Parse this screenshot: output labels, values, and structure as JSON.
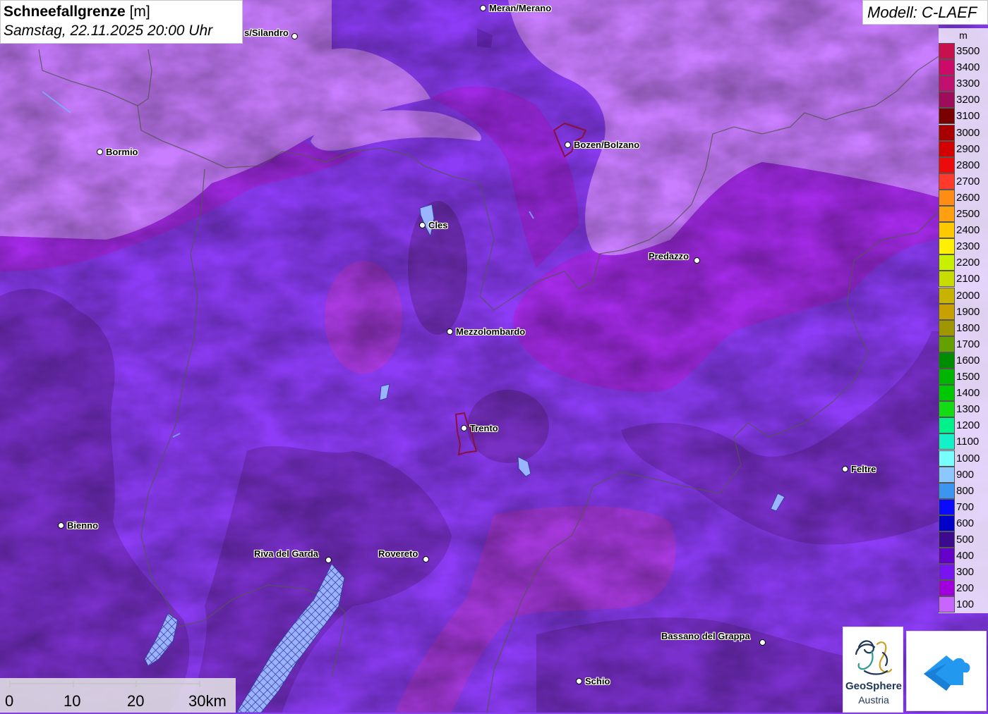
{
  "title": {
    "main": "Schneefallgrenze",
    "unit": "[m]",
    "datetime": "Samstag, 22.11.2025 20:00 Uhr"
  },
  "model": "Modell: C-LAEF",
  "legend": {
    "unit": "m",
    "items": [
      {
        "label": "3500",
        "color": "#c8104f"
      },
      {
        "label": "3400",
        "color": "#cc0a68"
      },
      {
        "label": "3300",
        "color": "#c21070"
      },
      {
        "label": "3200",
        "color": "#a00c5c"
      },
      {
        "label": "3100",
        "color": "#7a0000"
      },
      {
        "label": "3000",
        "color": "#a80000"
      },
      {
        "label": "2900",
        "color": "#d40000"
      },
      {
        "label": "2800",
        "color": "#ec0a0a"
      },
      {
        "label": "2700",
        "color": "#ff3a2a"
      },
      {
        "label": "2600",
        "color": "#ff8c14"
      },
      {
        "label": "2500",
        "color": "#ffa010"
      },
      {
        "label": "2400",
        "color": "#ffc800"
      },
      {
        "label": "2300",
        "color": "#fff000"
      },
      {
        "label": "2200",
        "color": "#c8f000"
      },
      {
        "label": "2100",
        "color": "#c8dc00"
      },
      {
        "label": "2000",
        "color": "#c8b400"
      },
      {
        "label": "1900",
        "color": "#c8a000"
      },
      {
        "label": "1800",
        "color": "#a09600"
      },
      {
        "label": "1700",
        "color": "#64a000"
      },
      {
        "label": "1600",
        "color": "#008c00"
      },
      {
        "label": "1500",
        "color": "#00b400"
      },
      {
        "label": "1400",
        "color": "#00c800"
      },
      {
        "label": "1300",
        "color": "#14dc14"
      },
      {
        "label": "1200",
        "color": "#00f08c"
      },
      {
        "label": "1100",
        "color": "#14f0c8"
      },
      {
        "label": "1000",
        "color": "#78ffff"
      },
      {
        "label": "900",
        "color": "#8cc8ff"
      },
      {
        "label": "800",
        "color": "#3c96f0"
      },
      {
        "label": "700",
        "color": "#0a0aff"
      },
      {
        "label": "600",
        "color": "#0000c8"
      },
      {
        "label": "500",
        "color": "#3c0a8c"
      },
      {
        "label": "400",
        "color": "#6400c8"
      },
      {
        "label": "300",
        "color": "#7814f0"
      },
      {
        "label": "200",
        "color": "#a000dc"
      },
      {
        "label": "100",
        "color": "#c864ff"
      }
    ]
  },
  "cities": [
    {
      "name": "Meran/Merano"
    },
    {
      "name": "s/Silandro"
    },
    {
      "name": "Bormio"
    },
    {
      "name": "Bozen/Bolzano"
    },
    {
      "name": "Cles"
    },
    {
      "name": "Predazzo"
    },
    {
      "name": "Mezzolombardo"
    },
    {
      "name": "Trento"
    },
    {
      "name": "Feltre"
    },
    {
      "name": "Bienno"
    },
    {
      "name": "Riva del Garda"
    },
    {
      "name": "Rovereto"
    },
    {
      "name": "Bassano del Grappa"
    },
    {
      "name": "Schio"
    }
  ],
  "scale": {
    "labels": [
      "0",
      "10",
      "20",
      "30km"
    ]
  },
  "logos": {
    "geosphere_line1": "GeoSphere",
    "geosphere_line2": "Austria"
  }
}
